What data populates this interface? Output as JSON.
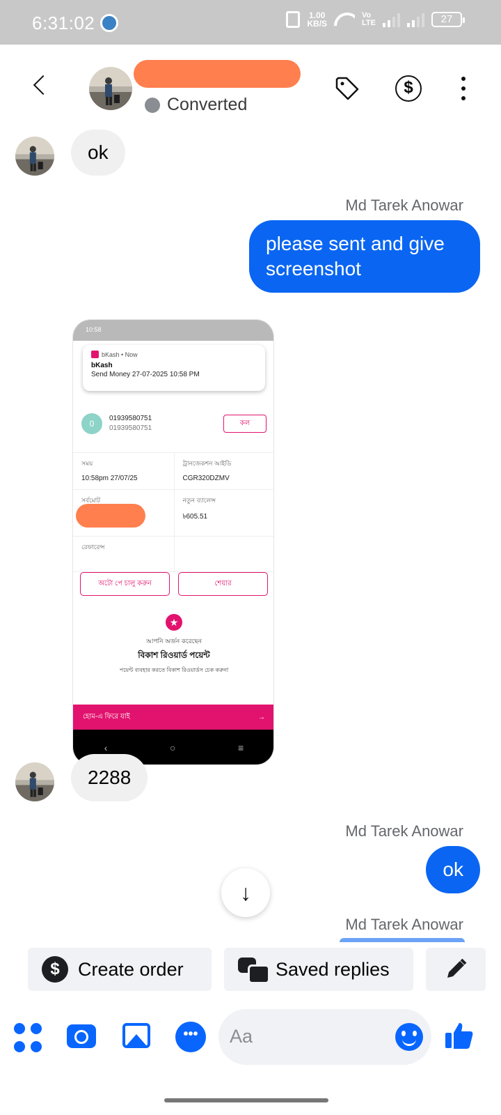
{
  "status_bar": {
    "time": "6:31:02",
    "net_speed_value": "1.00",
    "net_speed_unit": "KB/S",
    "volte_top": "Vo",
    "volte_bottom": "LTE",
    "battery": "27"
  },
  "header": {
    "contact_status": "Converted"
  },
  "messages": {
    "m1_text": "ok",
    "m2_sender": "Md Tarek Anowar",
    "m2_line1": "please sent and give",
    "m2_line2": "screenshot",
    "m4_text": "2288",
    "m5_sender": "Md Tarek Anowar",
    "m5_text": "ok",
    "m6_sender": "Md Tarek Anowar"
  },
  "attachment": {
    "status_time": "10:58",
    "notif_app": "bKash • Now",
    "notif_title": "bKash",
    "notif_body": "Send Money 27-07-2025 10:58 PM",
    "contact_initial": "0",
    "contact_number": "01939580751",
    "contact_number_sub": "01939580751",
    "call_label": "কল",
    "time_label": "সময়",
    "time_value": "10:58pm 27/07/25",
    "trx_label": "ট্রানজেকশন আইডি",
    "trx_value": "CGR320DZMV",
    "total_label": "সর্বমোট",
    "new_balance_label": "নতুন ব্যালেন্স",
    "new_balance_value": "৳605.51",
    "reference_label": "রেফারেন্স",
    "autopay_label": "অটো পে চালু করুন",
    "share_label": "শেয়ার",
    "reward_line1": "আপনি অর্জন করেছেন",
    "reward_line2": "বিকাশ রিওয়ার্ড পয়েন্ট",
    "reward_line3": "পয়েন্ট ব্যবহার করতে বিকাশ রিওয়ার্ডস চেক করুন!",
    "home_label": "হোম-এ ফিরে যাই",
    "home_arrow": "→"
  },
  "quick_actions": {
    "create_order_label": "Create order",
    "saved_replies_label": "Saved replies"
  },
  "composer": {
    "placeholder": "Aa"
  },
  "icons": {
    "dollar_glyph": "$",
    "down_arrow_glyph": "↓",
    "chat_glyph": "•••",
    "star_glyph": "★"
  },
  "colors": {
    "accent": "#0866ff",
    "outgoing_bubble": "#0a66f2",
    "incoming_bubble": "#f0f0f0",
    "bkash_pink": "#e2136e",
    "redaction": "#ff7f4f"
  }
}
